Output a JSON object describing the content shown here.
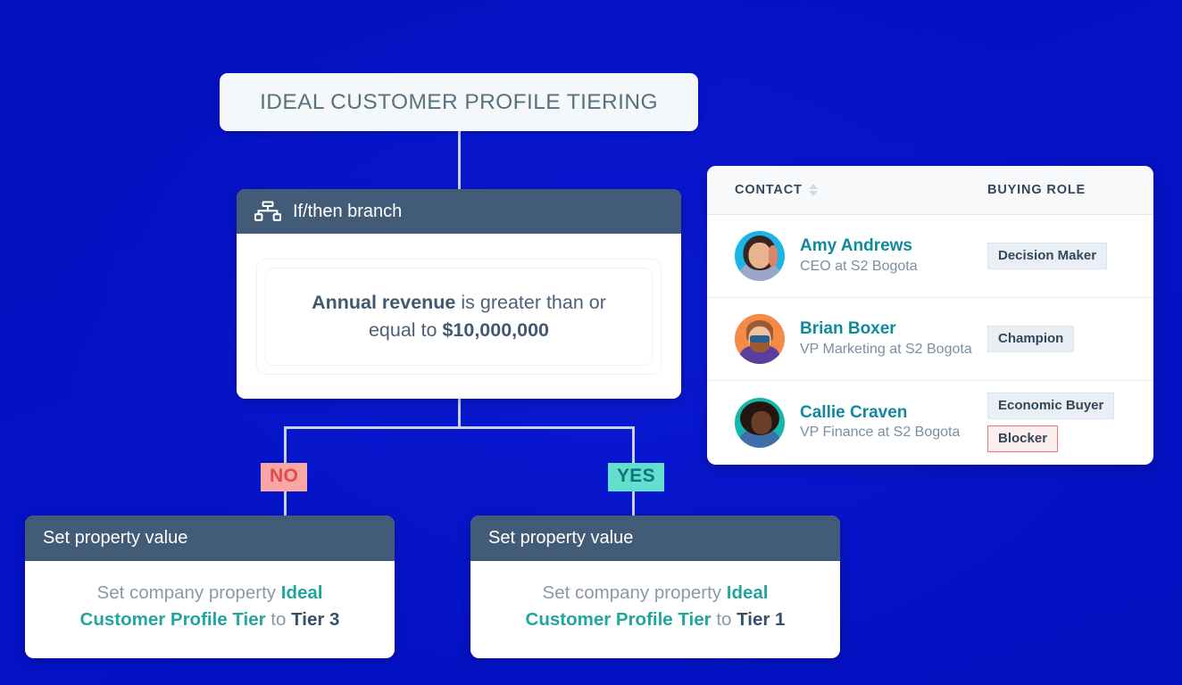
{
  "title_card": {
    "label": "IDEAL CUSTOMER PROFILE TIERING"
  },
  "branch_card": {
    "header_label": "If/then branch",
    "header_icon": "branch-hierarchy-icon",
    "condition": {
      "property": "Annual revenue",
      "operator": " is greater than or equal to ",
      "value": "$10,000,000"
    }
  },
  "branch_labels": {
    "no": "NO",
    "yes": "YES"
  },
  "action_no": {
    "header_label": "Set property value",
    "prefix": "Set company property ",
    "property": "Ideal Customer Profile Tier",
    "middle": " to ",
    "value": "Tier 3"
  },
  "action_yes": {
    "header_label": "Set property value",
    "prefix": "Set company property ",
    "property": "Ideal Customer Profile Tier",
    "middle": " to ",
    "value": "Tier 1"
  },
  "contacts_panel": {
    "columns": {
      "contact": "CONTACT",
      "buying_role": "BUYING ROLE"
    },
    "sort_icon": "sort-arrows-icon",
    "rows": [
      {
        "name": "Amy Andrews",
        "title": "CEO at S2 Bogota",
        "avatar": "avatar-amy-andrews",
        "roles": [
          {
            "label": "Decision Maker",
            "style": "default"
          }
        ]
      },
      {
        "name": "Brian Boxer",
        "title": "VP Marketing at S2 Bogota",
        "avatar": "avatar-brian-boxer",
        "roles": [
          {
            "label": "Champion",
            "style": "default"
          }
        ]
      },
      {
        "name": "Callie Craven",
        "title": "VP Finance at S2 Bogota",
        "avatar": "avatar-callie-craven",
        "roles": [
          {
            "label": "Economic Buyer",
            "style": "default"
          },
          {
            "label": "Blocker",
            "style": "alert"
          }
        ]
      }
    ]
  },
  "colors": {
    "background_blue": "#0512c4",
    "card_header_slate": "#425b76",
    "connector_gray": "#c8d2e0",
    "no_badge_bg": "#f9a6a6",
    "no_badge_text": "#e24a4a",
    "yes_badge_bg": "#63dfce",
    "yes_badge_text": "#10737f",
    "teal_property": "#22a5a0",
    "contact_link_teal": "#0e8a9c",
    "blocker_border": "#f2737a"
  }
}
